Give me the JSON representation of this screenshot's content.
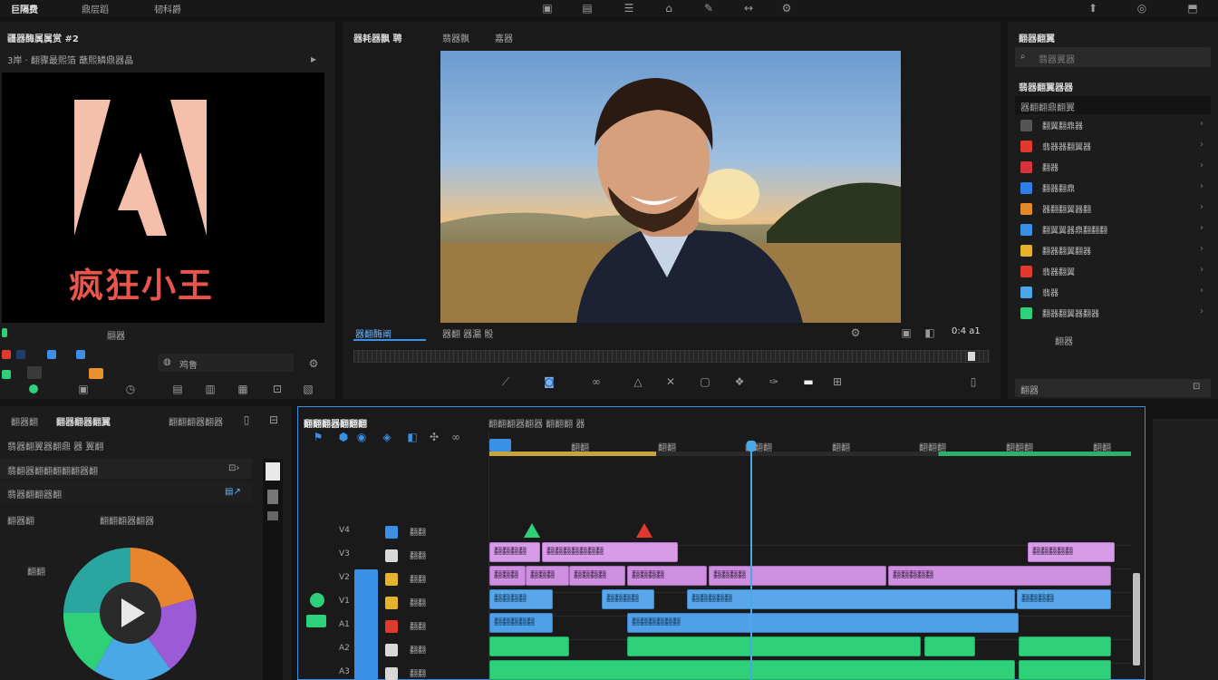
{
  "topbar": {
    "tabs": [
      "巨隔费",
      "鼎层蹈",
      "韧科爵"
    ],
    "tool_icons": [
      "frame-icon",
      "layout-icon",
      "list-icon",
      "home-icon",
      "brush-icon",
      "arrow-icon",
      "settings-icon"
    ],
    "right_icons": [
      "pin-icon",
      "account-icon",
      "export-icon"
    ]
  },
  "source_panel": {
    "title": "疆器酶属属赏 #2",
    "subtitle": "3岸 · 翻骤最熙箔 蘸熙鳞鼎器晶",
    "logo_text": "疯狂小王",
    "footer_label": "翮器",
    "field_value": "鸡鲁"
  },
  "program_panel": {
    "tabs": [
      "器耗器飘 聘",
      "翡器飘",
      "嘉器"
    ],
    "active_tab": "器翻酶阐",
    "tab2": "器翻 器漏 骰",
    "timecode": "0:4 a1"
  },
  "effects_panel": {
    "title": "翻器翻翼",
    "search_placeholder": "翡器翼器",
    "section": "翡器翻翼器器",
    "subsection": "器翻翻鼎翻翼",
    "items": [
      {
        "label": "翻翼翻鼎器",
        "color": "#555555",
        "icon": "film-icon"
      },
      {
        "label": "翡器器翻翼器",
        "color": "#e03a2f",
        "icon": "adobe-icon"
      },
      {
        "label": "翻器",
        "color": "#d8333a",
        "icon": "adobe-alt-icon"
      },
      {
        "label": "翻器翻鼎",
        "color": "#2f7fe6",
        "icon": "box-icon"
      },
      {
        "label": "器翻翻翼器翻",
        "color": "#e08a2a",
        "icon": "pen-icon"
      },
      {
        "label": "翻翼翼器鼎翻翻翻",
        "color": "#3a8fe6",
        "icon": "line-icon"
      },
      {
        "label": "翻器翻翼翻器",
        "color": "#e6b22a",
        "icon": "flag-icon"
      },
      {
        "label": "翡器翻翼",
        "color": "#e03a2f",
        "icon": "red-icon"
      },
      {
        "label": "翡器",
        "color": "#4aa8e6",
        "icon": "image-icon"
      },
      {
        "label": "翻器翻翼器翻器",
        "color": "#2fd07a",
        "icon": "green-icon"
      }
    ],
    "footer_label": "翻器",
    "bottom_field": "翻器"
  },
  "lumetri_panel": {
    "title": "翻器翻器翻翼",
    "row1": "翡器翻翼器翻鼎 器 翼翻",
    "row2": "翡翻器翻翻翻翻翻器翻",
    "row3": "翡器翻翻器翻",
    "row4a": "翻器翻",
    "row4b": "翻翻翻器翻器",
    "wheel_label": "翻翻"
  },
  "timeline": {
    "title": "翻翻翻器翻翻翻",
    "sequence_label": "翻翻翻器翻器 翻翻翻 器",
    "ruler_marks": [
      "翻翻",
      "翻翻",
      "翻翻翻",
      "翻翻",
      "翻翻翻",
      "翻翻翻",
      "翻翻"
    ],
    "playhead_fraction": 0.407,
    "tracks": [
      {
        "id": "V4",
        "name": "翻翻",
        "color": "#3a8fe6"
      },
      {
        "id": "V3",
        "name": "翻翻",
        "color": "#d8d8d8"
      },
      {
        "id": "V2",
        "name": "翻翻",
        "color": "#e6b22a"
      },
      {
        "id": "V1",
        "name": "翻翻",
        "color": "#e6b22a"
      },
      {
        "id": "A1",
        "name": "翻翻",
        "color": "#e03a2f"
      },
      {
        "id": "A2",
        "name": "翻翻",
        "color": "#d8d8d8"
      },
      {
        "id": "A3",
        "name": "翻翻",
        "color": "#d8d8d8"
      }
    ],
    "clips_v3": [
      "翻翻翻翻",
      "翻翻翻翻翻翻翻",
      "翻翻翻翻翻"
    ],
    "clips_v2": [
      "翻翻翻",
      "翻翻翻",
      "翻翻翻翻",
      "翻翻翻翻",
      "翻翻翻翻",
      "翻翻翻翻翻"
    ],
    "clips_a1": [
      "翻翻翻翻",
      "翻翻翻翻",
      "翻翻翻翻翻",
      "翻翻翻翻"
    ],
    "clips_a2": [
      "翻翻翻翻翻",
      "翻翻翻翻翻翻"
    ]
  },
  "colors": {
    "accent": "#3a8fe6",
    "panel": "#1c1c1c",
    "bg": "#141414",
    "logo": "#f4c0ac",
    "logo_text": "#e8554a"
  }
}
